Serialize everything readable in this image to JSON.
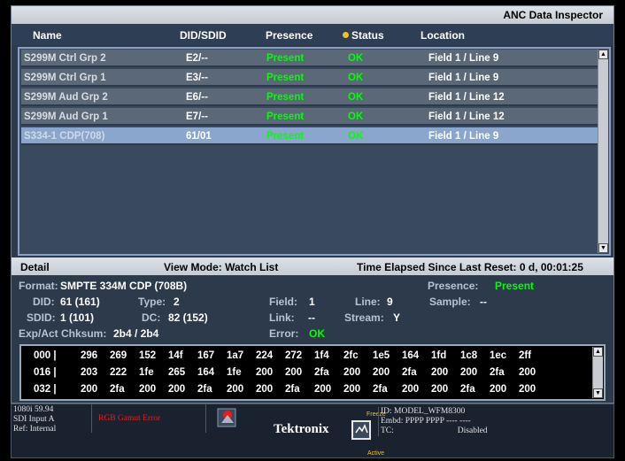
{
  "app": {
    "title": "ANC Data Inspector"
  },
  "columns": {
    "name": "Name",
    "did": "DID/SDID",
    "presence": "Presence",
    "status": "Status",
    "location": "Location"
  },
  "rows": [
    {
      "name": "S299M Ctrl Grp 2",
      "did": "E2/--",
      "presence": "Present",
      "status": "OK",
      "location": "Field 1 / Line 9"
    },
    {
      "name": "S299M Ctrl Grp 1",
      "did": "E3/--",
      "presence": "Present",
      "status": "OK",
      "location": "Field 1 / Line 9"
    },
    {
      "name": "S299M Aud Grp 2",
      "did": "E6/--",
      "presence": "Present",
      "status": "OK",
      "location": "Field 1 / Line 12"
    },
    {
      "name": "S299M Aud Grp 1",
      "did": "E7/--",
      "presence": "Present",
      "status": "OK",
      "location": "Field 1 / Line 12"
    },
    {
      "name": "S334-1 CDP(708)",
      "did": "61/01",
      "presence": "Present",
      "status": "OK",
      "location": "Field 1 / Line 9",
      "selected": true
    }
  ],
  "detail": {
    "title": "Detail",
    "view_mode": "View Mode: Watch List",
    "elapsed": "Time Elapsed Since Last Reset:  0 d, 00:01:25",
    "format_label": "Format:",
    "format_value": "SMPTE 334M CDP (708B)",
    "presence_label": "Presence:",
    "presence_value": "Present",
    "did_label": "DID:",
    "did_value": "61 (161)",
    "type_label": "Type:",
    "type_value": "2",
    "field_label": "Field:",
    "field_value": "1",
    "line_label": "Line:",
    "line_value": "9",
    "sample_label": "Sample:",
    "sample_value": "--",
    "sdid_label": "SDID:",
    "sdid_value": "1 (101)",
    "dc_label": "DC:",
    "dc_value": "82 (152)",
    "link_label": "Link:",
    "link_value": "--",
    "stream_label": "Stream:",
    "stream_value": "Y",
    "chk_label": "Exp/Act Chksum:",
    "chk_value": "2b4 / 2b4",
    "error_label": "Error:",
    "error_value": "OK"
  },
  "hex": [
    {
      "offset": "000  |",
      "values": [
        "296",
        "269",
        "152",
        "14f",
        "167",
        "1a7",
        "224",
        "272",
        "1f4",
        "2fc",
        "1e5",
        "164",
        "1fd",
        "1c8",
        "1ec",
        "2ff"
      ]
    },
    {
      "offset": "016  |",
      "values": [
        "203",
        "222",
        "1fe",
        "265",
        "164",
        "1fe",
        "200",
        "200",
        "2fa",
        "200",
        "200",
        "2fa",
        "200",
        "200",
        "2fa",
        "200"
      ]
    },
    {
      "offset": "032  |",
      "values": [
        "200",
        "2fa",
        "200",
        "200",
        "2fa",
        "200",
        "200",
        "2fa",
        "200",
        "200",
        "2fa",
        "200",
        "200",
        "2fa",
        "200",
        "200"
      ]
    }
  ],
  "statusbar": {
    "format": "1080i 59.94",
    "input": "SDI Input A",
    "ref": "Ref: Internal",
    "error": "RGB Gamut Error",
    "brand": "Tektronix",
    "freeze": "Freeze",
    "active": "Active",
    "id": "ID: MODEL_WFM8300",
    "embd": "Embd: PPPP PPPP ---- ----",
    "tc_label": "TC:",
    "tc_value": "Disabled"
  },
  "colors": {
    "ok": "#00ff00",
    "selected": "#8aa6cc",
    "background": "#2c3a4c"
  }
}
